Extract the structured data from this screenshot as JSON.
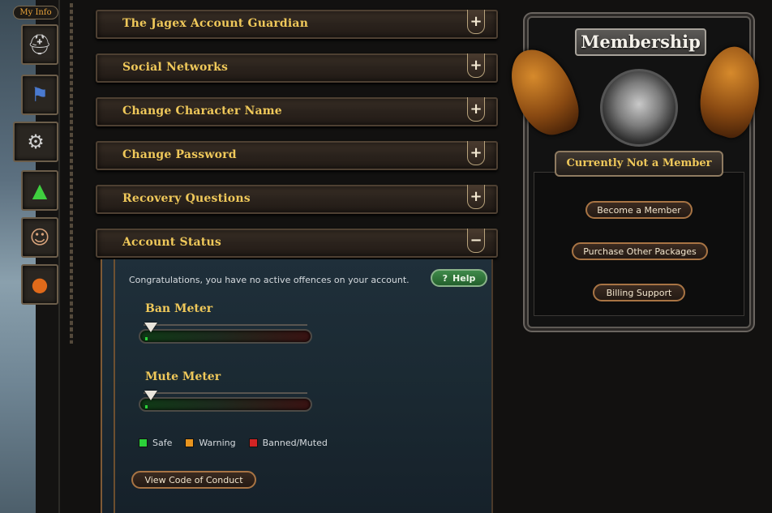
{
  "sidebar": {
    "my_info_label": "My Info",
    "items": [
      {
        "name": "helmet-icon",
        "glyph": "⛑"
      },
      {
        "name": "banner-icon",
        "glyph": "⚑"
      },
      {
        "name": "gear-icon",
        "glyph": "⚙"
      },
      {
        "name": "upgrade-icon",
        "glyph": "▲"
      },
      {
        "name": "avatar-icon",
        "glyph": "☺"
      },
      {
        "name": "bomb-icon",
        "glyph": "●"
      }
    ]
  },
  "account_sections": [
    {
      "title": "The Jagex Account Guardian",
      "toggle": "+"
    },
    {
      "title": "Social Networks",
      "toggle": "+"
    },
    {
      "title": "Change Character Name",
      "toggle": "+"
    },
    {
      "title": "Change Password",
      "toggle": "+"
    },
    {
      "title": "Recovery Questions",
      "toggle": "+"
    },
    {
      "title": "Account Status",
      "toggle": "−"
    }
  ],
  "account_status": {
    "message": "Congratulations, you have no active offences on your account.",
    "help_label": "Help",
    "help_glyph": "?",
    "ban_meter": {
      "title": "Ban Meter",
      "level": 0
    },
    "mute_meter": {
      "title": "Mute Meter",
      "level": 0
    },
    "legend": [
      {
        "label": "Safe",
        "color": "#2bd13a"
      },
      {
        "label": "Warning",
        "color": "#e8951f"
      },
      {
        "label": "Banned/Muted",
        "color": "#d22424"
      }
    ],
    "code_of_conduct_label": "View Code of Conduct"
  },
  "membership": {
    "title": "Membership",
    "status": "Currently Not a Member",
    "buttons": [
      "Become a Member",
      "Purchase Other Packages",
      "Billing Support"
    ]
  }
}
